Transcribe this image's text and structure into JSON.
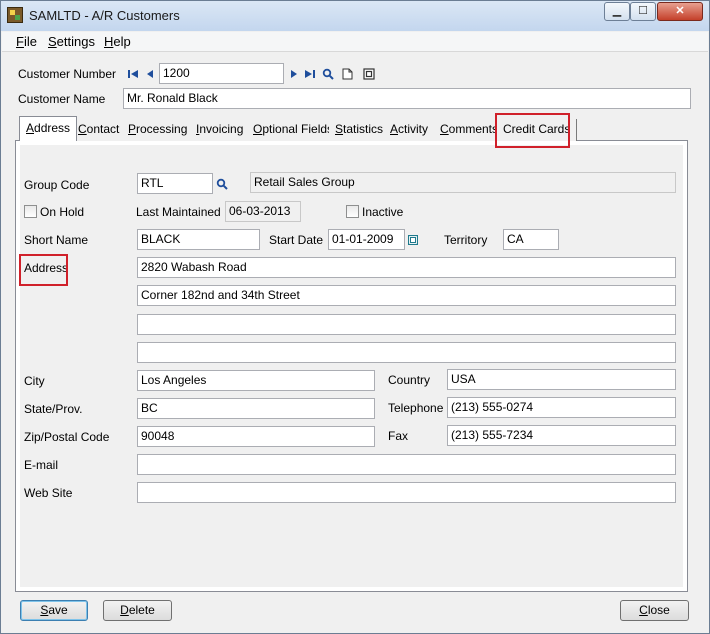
{
  "window": {
    "title": "SAMLTD - A/R Customers",
    "controls": {
      "minimize": "▁",
      "maximize": "☐",
      "close": "✕"
    }
  },
  "menu": {
    "file": {
      "key": "F",
      "rest": "ile"
    },
    "settings": {
      "key": "S",
      "rest": "ettings"
    },
    "help": {
      "key": "H",
      "rest": "elp"
    }
  },
  "header": {
    "customer_number_label": "Customer Number",
    "customer_number": "1200",
    "customer_name_label": "Customer Name",
    "customer_name": "Mr. Ronald Black"
  },
  "tabs": [
    {
      "key": "A",
      "rest": "ddress"
    },
    {
      "key": "C",
      "rest": "ontact"
    },
    {
      "key": "P",
      "rest": "rocessing"
    },
    {
      "key": "I",
      "rest": "nvoicing"
    },
    {
      "key": "O",
      "rest": "ptional Fields"
    },
    {
      "key": "S",
      "rest": "tatistics"
    },
    {
      "key": "A",
      "rest": "ctivity"
    },
    {
      "key": "C",
      "rest": "omments"
    },
    {
      "key": "",
      "rest": "Credit Cards"
    }
  ],
  "address_tab": {
    "group_code_label": "Group Code",
    "group_code": "RTL",
    "group_description": "Retail Sales Group",
    "on_hold_label": "On Hold",
    "last_maintained_label": "Last Maintained",
    "last_maintained": "06-03-2013",
    "inactive_label": "Inactive",
    "short_name_label": "Short Name",
    "short_name": "BLACK",
    "start_date_label": "Start Date",
    "start_date": "01-01-2009",
    "territory_label": "Territory",
    "territory": "CA",
    "address_label": "Address",
    "address_lines": [
      "2820 Wabash Road",
      "Corner 182nd and 34th Street",
      "",
      ""
    ],
    "city_label": "City",
    "city": "Los Angeles",
    "country_label": "Country",
    "country": "USA",
    "state_label": "State/Prov.",
    "state": "BC",
    "telephone_label": "Telephone",
    "telephone": "(213) 555-0274",
    "zip_label": "Zip/Postal Code",
    "zip": "90048",
    "fax_label": "Fax",
    "fax": "(213) 555-7234",
    "email_label": "E-mail",
    "email": "",
    "website_label": "Web Site",
    "website": ""
  },
  "buttons": {
    "save": {
      "key": "S",
      "rest": "ave"
    },
    "delete": {
      "key": "D",
      "rest": "elete"
    },
    "close": {
      "key": "C",
      "rest": "lose"
    }
  },
  "colors": {
    "highlight": "#d0202a",
    "finder_icon": "#1f4e9c"
  }
}
